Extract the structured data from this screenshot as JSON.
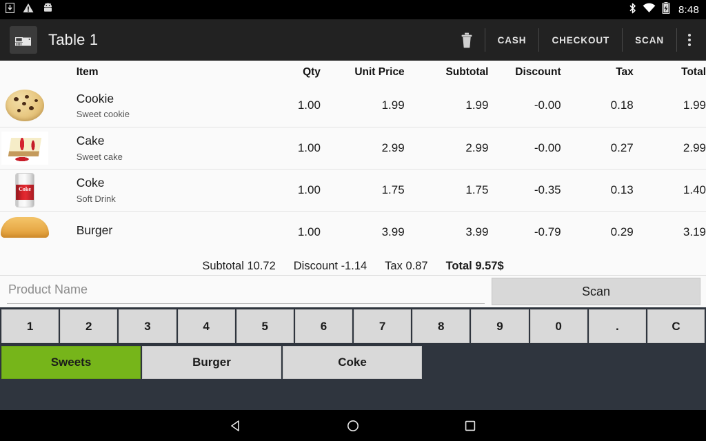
{
  "status_bar": {
    "icons": [
      "download-icon",
      "warning-icon",
      "android-icon"
    ],
    "right_icons": [
      "bluetooth-icon",
      "wifi-icon",
      "battery-charging-icon"
    ],
    "time": "8:48"
  },
  "app_bar": {
    "logo_icon": "cash-register-icon",
    "title": "Table 1",
    "delete_icon": "trash-icon",
    "actions": [
      {
        "label": "CASH",
        "name": "cash-button"
      },
      {
        "label": "CHECKOUT",
        "name": "checkout-button"
      },
      {
        "label": "SCAN",
        "name": "scan-action-button"
      }
    ],
    "overflow_icon": "more-vertical-icon"
  },
  "cart": {
    "columns": [
      "Item",
      "Qty",
      "Unit Price",
      "Subtotal",
      "Discount",
      "Tax",
      "Total"
    ],
    "rows": [
      {
        "image": "cookie-image",
        "name": "Cookie",
        "description": "Sweet cookie",
        "qty": "1.00",
        "unit_price": "1.99",
        "subtotal": "1.99",
        "discount": "-0.00",
        "tax": "0.18",
        "total": "1.99"
      },
      {
        "image": "cake-image",
        "name": "Cake",
        "description": "Sweet cake",
        "qty": "1.00",
        "unit_price": "2.99",
        "subtotal": "2.99",
        "discount": "-0.00",
        "tax": "0.27",
        "total": "2.99"
      },
      {
        "image": "coke-can-image",
        "name": "Coke",
        "description": "Soft Drink",
        "qty": "1.00",
        "unit_price": "1.75",
        "subtotal": "1.75",
        "discount": "-0.35",
        "tax": "0.13",
        "total": "1.40"
      },
      {
        "image": "burger-image",
        "name": "Burger",
        "description": "",
        "qty": "1.00",
        "unit_price": "3.99",
        "subtotal": "3.99",
        "discount": "-0.79",
        "tax": "0.29",
        "total": "3.19"
      }
    ]
  },
  "summary": {
    "subtotal_label": "Subtotal",
    "subtotal_value": "10.72",
    "discount_label": "Discount",
    "discount_value": "-1.14",
    "tax_label": "Tax",
    "tax_value": "0.87",
    "total_label": "Total",
    "total_value": "9.57$"
  },
  "input_row": {
    "product_placeholder": "Product Name",
    "product_value": "",
    "scan_label": "Scan"
  },
  "keypad": {
    "keys": [
      "1",
      "2",
      "3",
      "4",
      "5",
      "6",
      "7",
      "8",
      "9",
      "0",
      ".",
      "C"
    ]
  },
  "categories": {
    "selected": "Sweets",
    "items": [
      {
        "label": "Sweets",
        "selected": true
      },
      {
        "label": "Burger",
        "selected": false
      },
      {
        "label": "Coke",
        "selected": false
      }
    ],
    "selected_color": "#76b51a"
  },
  "nav_bar": {
    "back_icon": "triangle-back-icon",
    "home_icon": "circle-home-icon",
    "recents_icon": "square-recents-icon"
  }
}
